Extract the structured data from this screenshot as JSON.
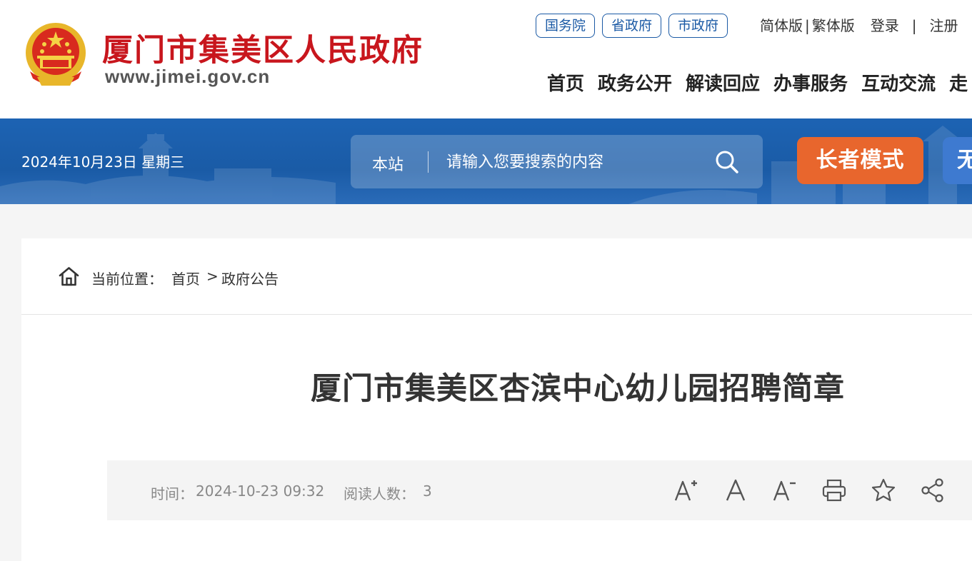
{
  "header": {
    "site_title": "厦门市集美区人民政府",
    "site_url": "www.jimei.gov.cn",
    "gov_links": [
      "国务院",
      "省政府",
      "市政府"
    ],
    "util": {
      "simplified": "简体版",
      "sep": "|",
      "traditional": "繁体版",
      "login": "登录",
      "register": "注册"
    },
    "nav": [
      "首页",
      "政务公开",
      "解读回应",
      "办事服务",
      "互动交流",
      "走"
    ]
  },
  "banner": {
    "date": "2024年10月23日 星期三",
    "search_scope": "本站",
    "search_placeholder": "请输入您要搜索的内容",
    "elder_mode": "长者模式",
    "accessibility": "无"
  },
  "breadcrumb": {
    "label": "当前位置：",
    "home": "首页",
    "separator": ">",
    "current": "政府公告"
  },
  "article": {
    "title": "厦门市集美区杏滨中心幼儿园招聘简章",
    "time_label": "时间：",
    "time": "2024-10-23 09:32",
    "reads_label": "阅读人数：",
    "reads": "3"
  },
  "tools": [
    "font-increase-icon",
    "font-normal-icon",
    "font-decrease-icon",
    "print-icon",
    "favorite-star-icon",
    "share-icon"
  ],
  "colors": {
    "brand_red": "#c8161d",
    "brand_blue": "#1b5aa5",
    "elder_orange": "#e8662d"
  }
}
